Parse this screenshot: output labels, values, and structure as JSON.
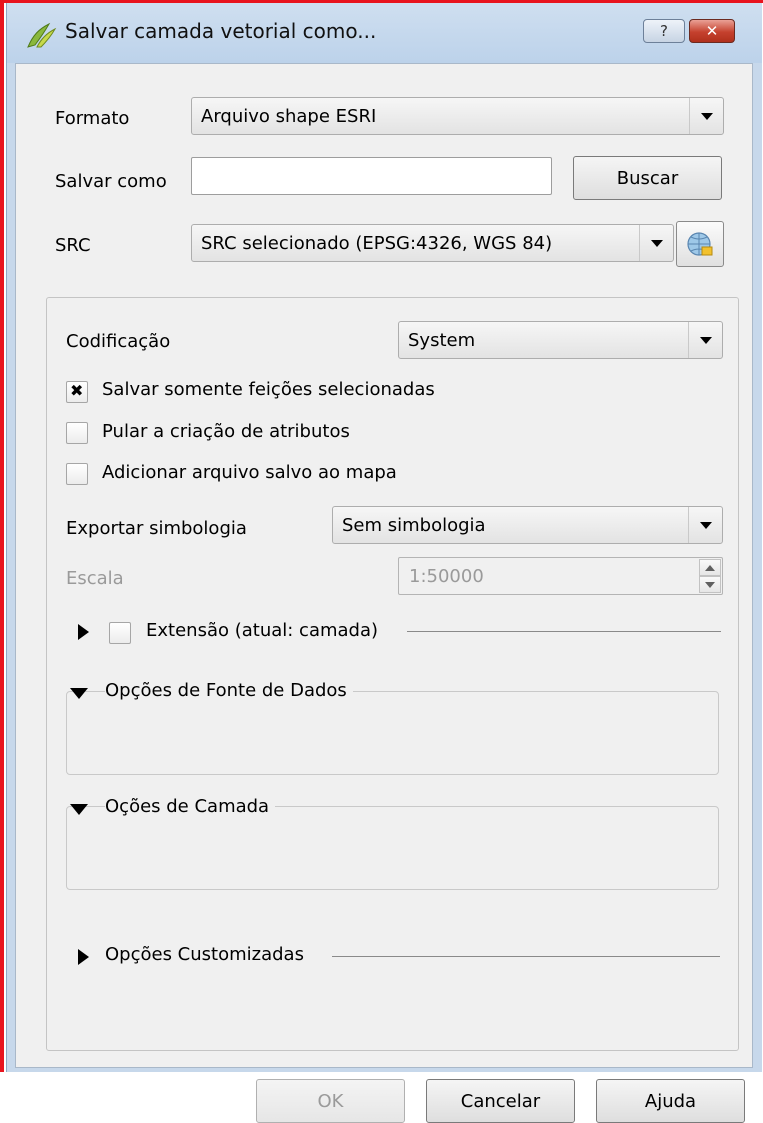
{
  "window": {
    "title": "Salvar camada vetorial como...",
    "help_glyph": "?",
    "close_glyph": "✕"
  },
  "form": {
    "format_label": "Formato",
    "format_value": "Arquivo shape ESRI",
    "save_as_label": "Salvar como",
    "save_as_value": "",
    "browse_label": "Buscar",
    "crs_label": "SRC",
    "crs_value": "SRC selecionado (EPSG:4326, WGS 84)"
  },
  "options": {
    "encoding_label": "Codificação",
    "encoding_value": "System",
    "checkboxes": [
      {
        "label": "Salvar somente feições selecionadas",
        "checked": true
      },
      {
        "label": "Pular a criação de atributos",
        "checked": false
      },
      {
        "label": "Adicionar arquivo salvo ao mapa",
        "checked": false
      }
    ],
    "symbology_label": "Exportar simbologia",
    "symbology_value": "Sem simbologia",
    "scale_label": "Escala",
    "scale_value": "1:50000",
    "extent_label": "Extensão (atual: camada)",
    "extent_checked": false,
    "datasource_label": "Opções de Fonte de Dados",
    "layer_label": "Oções de Camada",
    "custom_label": "Opções Customizadas"
  },
  "buttons": {
    "ok": "OK",
    "cancel": "Cancelar",
    "help": "Ajuda"
  },
  "colors": {
    "frame_accent": "#e8141e",
    "titlebar": "#c7d8eb",
    "client": "#f0f0f0"
  }
}
